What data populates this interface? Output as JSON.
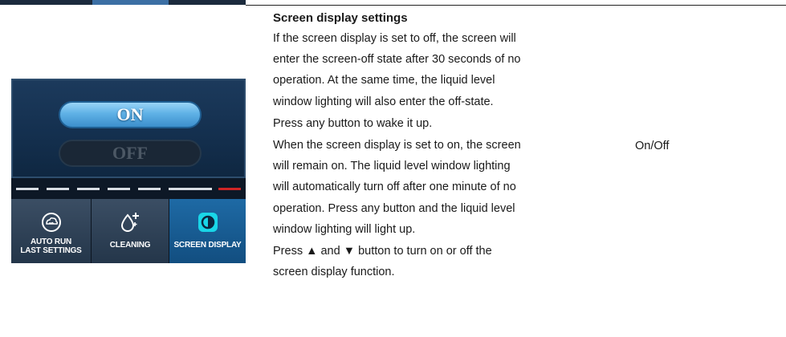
{
  "device": {
    "on_label": "ON",
    "off_label": "OFF",
    "tabs": [
      {
        "label_line1": "AUTO RUN",
        "label_line2": "LAST SETTINGS"
      },
      {
        "label_line1": "CLEANING",
        "label_line2": ""
      },
      {
        "label_line1": "SCREEN DISPLAY",
        "label_line2": ""
      }
    ],
    "active_tab": 2,
    "colors": {
      "accent": "#3c8fcc",
      "active_tab": "#1e6aa5",
      "indicator_red": "#d02525"
    }
  },
  "section": {
    "title": "Screen display settings",
    "lines": [
      "If the screen display is set to off, the screen will",
      "enter the screen-off state after 30 seconds of no",
      "operation. At the same time, the liquid level",
      "window lighting will also enter the off-state.",
      "Press any button to wake it up.",
      "When the screen display is set to on, the screen",
      "will remain on. The liquid level window lighting",
      "will automatically turn off after one minute of no",
      "operation. Press any button and the liquid level",
      "window lighting will light up.",
      "Press ▲ and ▼ button to turn on or off the",
      "screen display function."
    ],
    "value": "On/Off"
  }
}
